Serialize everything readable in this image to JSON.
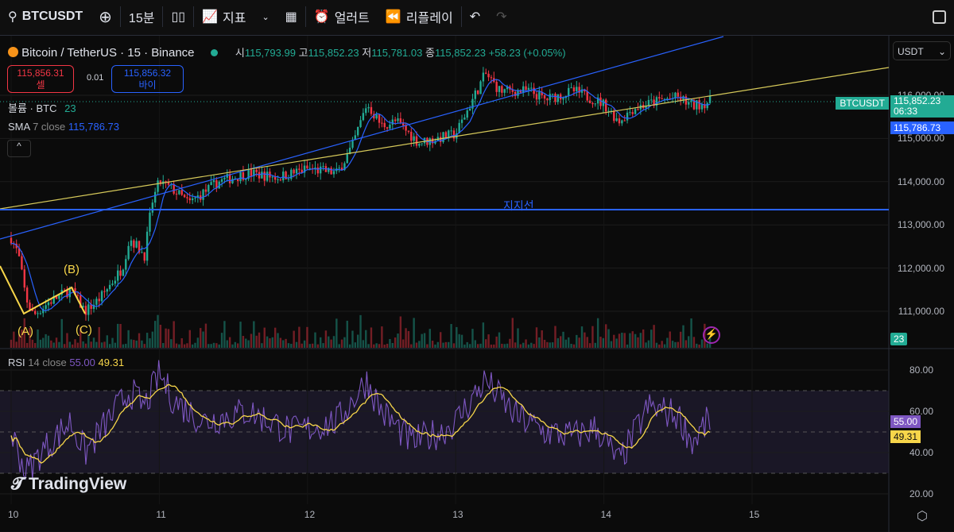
{
  "toolbar": {
    "symbol": "BTCUSDT",
    "interval": "15분",
    "indicators": "지표",
    "alert": "얼러트",
    "replay": "리플레이"
  },
  "legend": {
    "title": "Bitcoin / TetherUS · 15 · Binance",
    "o_label": "시",
    "o": "115,793.99",
    "h_label": "고",
    "h": "115,852.23",
    "l_label": "저",
    "l": "115,781.03",
    "c_label": "종",
    "c": "115,852.23",
    "change": "+58.23 (+0.05%)",
    "sell_price": "115,856.31",
    "sell_label": "셀",
    "spread": "0.01",
    "buy_price": "115,856.32",
    "buy_label": "바이",
    "volume_label": "볼륨 · BTC",
    "volume_value": "23",
    "sma_label": "SMA",
    "sma_params": "7 close",
    "sma_value": "115,786.73",
    "rsi_label": "RSI",
    "rsi_params": "14 close",
    "rsi_value": "55.00",
    "rsi_ma_value": "49.31"
  },
  "currency": "USDT",
  "price_tags": {
    "symbol": "BTCUSDT",
    "last": "115,852.23",
    "countdown": "06:33",
    "sma": "115,786.73",
    "volume": "23",
    "rsi": "55.00",
    "rsi_ma": "49.31"
  },
  "annotations": {
    "support": "지지선",
    "a": "(A)",
    "b": "(B)",
    "c": "(C)"
  },
  "watermark": "TradingView",
  "colors": {
    "up": "#22ab94",
    "down": "#f23645",
    "sma": "#2962ff",
    "rsi": "#7e57c2",
    "rsi_ma": "#f7d64a"
  },
  "chart_data": {
    "type": "candlestick",
    "price_axis": [
      "116,000.00",
      "115,000.00",
      "114,000.00",
      "113,000.00",
      "112,000.00",
      "111,000.00"
    ],
    "rsi_axis": [
      "80.00",
      "60.00",
      "40.00",
      "20.00"
    ],
    "time_axis": [
      "10",
      "11",
      "12",
      "13",
      "14",
      "15"
    ],
    "price_path": [
      [
        10.0,
        112700
      ],
      [
        10.05,
        112300
      ],
      [
        10.1,
        111300
      ],
      [
        10.15,
        110900
      ],
      [
        10.25,
        111200
      ],
      [
        10.4,
        111500
      ],
      [
        10.5,
        111000
      ],
      [
        10.6,
        111300
      ],
      [
        10.75,
        112000
      ],
      [
        10.8,
        112700
      ],
      [
        10.9,
        112300
      ],
      [
        10.95,
        113500
      ],
      [
        11.0,
        114000
      ],
      [
        11.1,
        113800
      ],
      [
        11.2,
        113500
      ],
      [
        11.4,
        114000
      ],
      [
        11.6,
        114200
      ],
      [
        11.8,
        114100
      ],
      [
        12.0,
        114300
      ],
      [
        12.2,
        114200
      ],
      [
        12.3,
        114800
      ],
      [
        12.4,
        115800
      ],
      [
        12.5,
        115300
      ],
      [
        12.6,
        115400
      ],
      [
        12.75,
        114900
      ],
      [
        13.0,
        115100
      ],
      [
        13.1,
        115800
      ],
      [
        13.2,
        116500
      ],
      [
        13.3,
        116100
      ],
      [
        13.5,
        116100
      ],
      [
        13.6,
        115900
      ],
      [
        13.8,
        116100
      ],
      [
        14.0,
        115800
      ],
      [
        14.1,
        115400
      ],
      [
        14.2,
        115700
      ],
      [
        14.4,
        115900
      ],
      [
        14.5,
        115950
      ],
      [
        14.6,
        115750
      ],
      [
        14.7,
        115850
      ]
    ],
    "rsi_path": [
      [
        10.0,
        50
      ],
      [
        10.1,
        30
      ],
      [
        10.2,
        40
      ],
      [
        10.4,
        55
      ],
      [
        10.5,
        40
      ],
      [
        10.7,
        60
      ],
      [
        10.8,
        70
      ],
      [
        10.9,
        62
      ],
      [
        11.0,
        78
      ],
      [
        11.1,
        65
      ],
      [
        11.3,
        55
      ],
      [
        11.6,
        60
      ],
      [
        11.9,
        50
      ],
      [
        12.2,
        55
      ],
      [
        12.4,
        75
      ],
      [
        12.5,
        60
      ],
      [
        12.7,
        45
      ],
      [
        12.9,
        50
      ],
      [
        13.0,
        55
      ],
      [
        13.2,
        75
      ],
      [
        13.4,
        58
      ],
      [
        13.6,
        50
      ],
      [
        13.8,
        48
      ],
      [
        13.95,
        52
      ],
      [
        14.1,
        35
      ],
      [
        14.3,
        62
      ],
      [
        14.5,
        58
      ],
      [
        14.6,
        45
      ],
      [
        14.7,
        55
      ]
    ],
    "rsi_bands": [
      70,
      50,
      30
    ]
  }
}
